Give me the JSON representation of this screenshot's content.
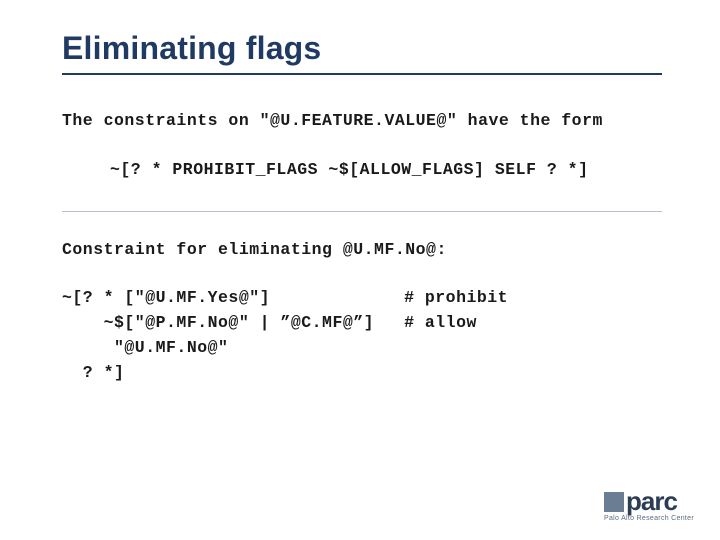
{
  "title": "Eliminating flags",
  "intro": "The constraints on \"@U.FEATURE.VALUE@\" have the form",
  "template": "~[? * PROHIBIT_FLAGS ~$[ALLOW_FLAGS] SELF ? *]",
  "example_heading": "Constraint for eliminating @U.MF.No@:",
  "example_left": "~[? * [\"@U.MF.Yes@\"]\n    ~$[\"@P.MF.No@\" | ”@C.MF@”]\n     \"@U.MF.No@\"\n  ? *]",
  "example_right": "# prohibit\n# allow",
  "logo": {
    "text": "parc",
    "sub": "Palo Alto Research Center"
  }
}
